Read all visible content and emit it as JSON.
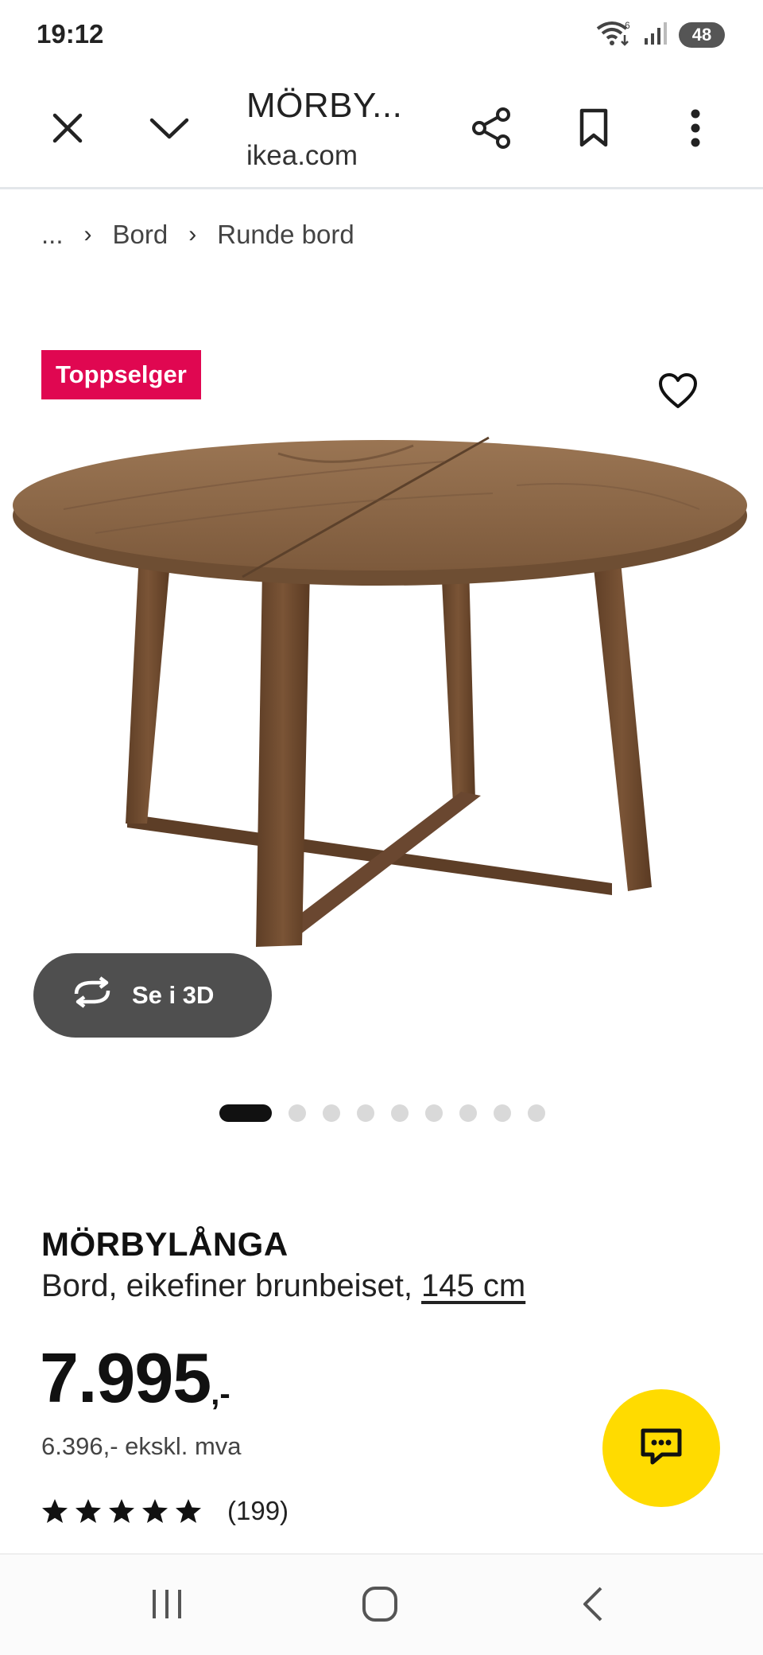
{
  "status_bar": {
    "time": "19:12",
    "wifi_badge": "6",
    "battery": "48",
    "icons": [
      "wifi-icon",
      "signal-icon",
      "battery-icon"
    ]
  },
  "toolbar": {
    "title": "MÖRBY...",
    "url": "ikea.com",
    "icons": [
      "close-icon",
      "chevron-down-icon",
      "share-icon",
      "bookmark-icon",
      "more-vert-icon"
    ]
  },
  "breadcrumb": {
    "items": [
      "...",
      "Bord",
      "Runde bord"
    ]
  },
  "badge": "Toppselger",
  "view_3d": {
    "label": "Se i 3D",
    "icon": "rotate-icon"
  },
  "carousel": {
    "total": 9,
    "active": 1
  },
  "product": {
    "name": "MÖRBYLÅNGA",
    "description": "Bord, eikefiner brunbeiset, ",
    "size_link": "145 cm",
    "price_main": "7.995",
    "price_suffix": ",-",
    "price_ex_vat": "6.396,- ekskl. mva",
    "rating_stars": 5,
    "rating_count": "(199)"
  },
  "colors": {
    "badge_bg": "#e00751",
    "chat_fab": "#ffdb00",
    "btn_3d_bg": "#4f4f4f"
  }
}
